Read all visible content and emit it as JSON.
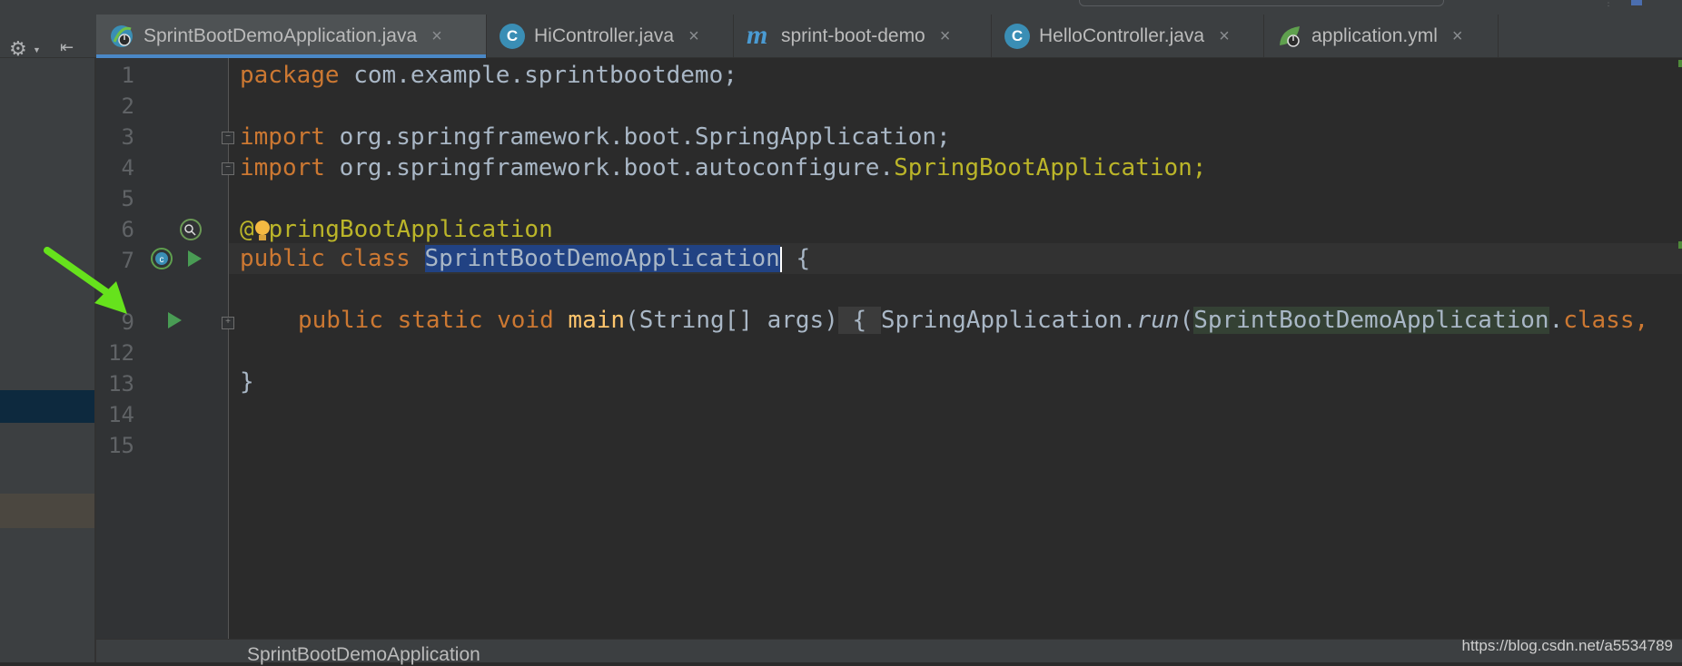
{
  "tabs": [
    {
      "label": "SprintBootDemoApplication.java",
      "icon": "spring-boot-class-icon",
      "active": true
    },
    {
      "label": "HiController.java",
      "icon": "class-icon",
      "active": false
    },
    {
      "label": "sprint-boot-demo",
      "icon": "maven-icon",
      "active": false
    },
    {
      "label": "HelloController.java",
      "icon": "class-icon",
      "active": false
    },
    {
      "label": "application.yml",
      "icon": "spring-config-icon",
      "active": false
    }
  ],
  "close_glyph": "×",
  "line_numbers": [
    "1",
    "2",
    "3",
    "4",
    "5",
    "6",
    "7",
    "9",
    "12",
    "13",
    "14",
    "15"
  ],
  "code": {
    "l1_kw": "package",
    "l1_rest": " com.example.sprintbootdemo;",
    "l3_kw": "import",
    "l3_rest": " org.springframework.boot.SpringApplication;",
    "l4_kw": "import",
    "l4_pkg": " org.springframework.boot.autoconfigure.",
    "l4_cls": "SpringBootApplication;",
    "l6_at": "@",
    "l6_rest": "pringBootApplication",
    "l7_kw": "public class ",
    "l7_sel": "SprintBootDemoApplication",
    "l7_rest": " {",
    "l9_kw": "public static void ",
    "l9_fn": "main",
    "l9_args": "(String[] args)",
    "l9_brace": " { ",
    "l9_call": "SpringApplication.",
    "l9_run": "run",
    "l9_paren": "(",
    "l9_cls": "SprintBootDemoApplication",
    "l9_dot": ".",
    "l9_classkw": "class,",
    "l13": "}"
  },
  "breadcrumb": "SprintBootDemoApplication",
  "watermark": "https://blog.csdn.net/a5534789",
  "colors": {
    "keyword": "#cc7832",
    "annotation": "#bbb529",
    "method": "#ffc66d",
    "selection": "#214283",
    "run": "#499c54"
  }
}
